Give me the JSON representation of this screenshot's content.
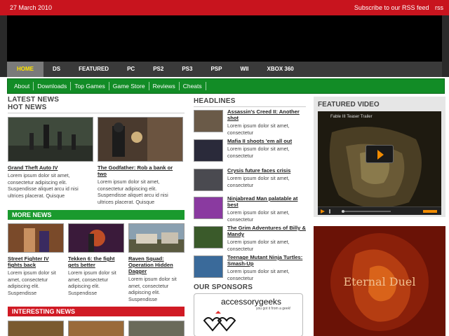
{
  "topbar": {
    "date": "27 March 2010",
    "subscribe": "Subscribe to our RSS feed",
    "rss": "rss"
  },
  "platform_nav": {
    "items": [
      "HOME",
      "DS",
      "FEATURED",
      "PC",
      "PS2",
      "PS3",
      "PSP",
      "WII",
      "XBOX 360"
    ],
    "active": "HOME"
  },
  "sub_nav": {
    "items": [
      "About",
      "Downloads",
      "Top Games",
      "Game Store",
      "Reviews",
      "Cheats"
    ]
  },
  "left": {
    "latest_news": "LATEST NEWS",
    "hot_news": "HOT NEWS",
    "hot": [
      {
        "title": "Grand Theft Auto IV",
        "excerpt": "Lorem ipsum dolor sit amet, consectetur adipiscing elit. Suspendisse aliquet arcu id nisi ultrices placerat. Quisque"
      },
      {
        "title": "The Godfather: Rob a bank or two",
        "excerpt": "Lorem ipsum dolor sit amet, consectetur adipiscing elit. Suspendisse aliquet arcu id nisi ultrices placerat. Quisque"
      }
    ],
    "more_news": "MORE NEWS",
    "more": [
      {
        "title": "Street Fighter IV fights back",
        "excerpt": "Lorem ipsum dolor sit amet, consectetur adipiscing elit. Suspendisse"
      },
      {
        "title": "Tekken 6: the fight gets better",
        "excerpt": "Lorem ipsum dolor sit amet, consectetur adipiscing elit. Suspendisse"
      },
      {
        "title": "Raven Squad: Operation Hidden Dagger",
        "excerpt": "Lorem ipsum dolor sit amet, consectetur adipiscing elit. Suspendisse"
      }
    ],
    "interesting_news": "INTERESTING NEWS"
  },
  "headlines": {
    "title": "HEADLINES",
    "items": [
      {
        "title": "Assassin's Creed II: Another shot",
        "excerpt": "Lorem ipsum dolor sit amet, consectetur"
      },
      {
        "title": "Mafia II shoots 'em all out",
        "excerpt": "Lorem ipsum dolor sit amet, consectetur"
      },
      {
        "title": "Crysis future faces crisis",
        "excerpt": "Lorem ipsum dolor sit amet, consectetur"
      },
      {
        "title": "Ninjabread Man palatable at best",
        "excerpt": "Lorem ipsum dolor sit amet, consectetur"
      },
      {
        "title": "The Grim Adventures of Billy & Mandy",
        "excerpt": "Lorem ipsum dolor sit amet, consectetur"
      },
      {
        "title": "Teenage Mutant Ninja Turtles: Smash-Up",
        "excerpt": "Lorem ipsum dolor sit amet, consectetur"
      }
    ]
  },
  "sponsors": {
    "title": "OUR SPONSORS",
    "logo_text": "accessorygeeks",
    "tagline": "you got it from a geek!"
  },
  "featured_video": {
    "title": "FEATURED VIDEO",
    "video_title": "Fable III Teaser Trailer"
  },
  "promo": {
    "text": "Eternal Duel"
  },
  "colors": {
    "red": "#c8141e",
    "green": "#128c26",
    "nav_active": "#ffe400"
  }
}
